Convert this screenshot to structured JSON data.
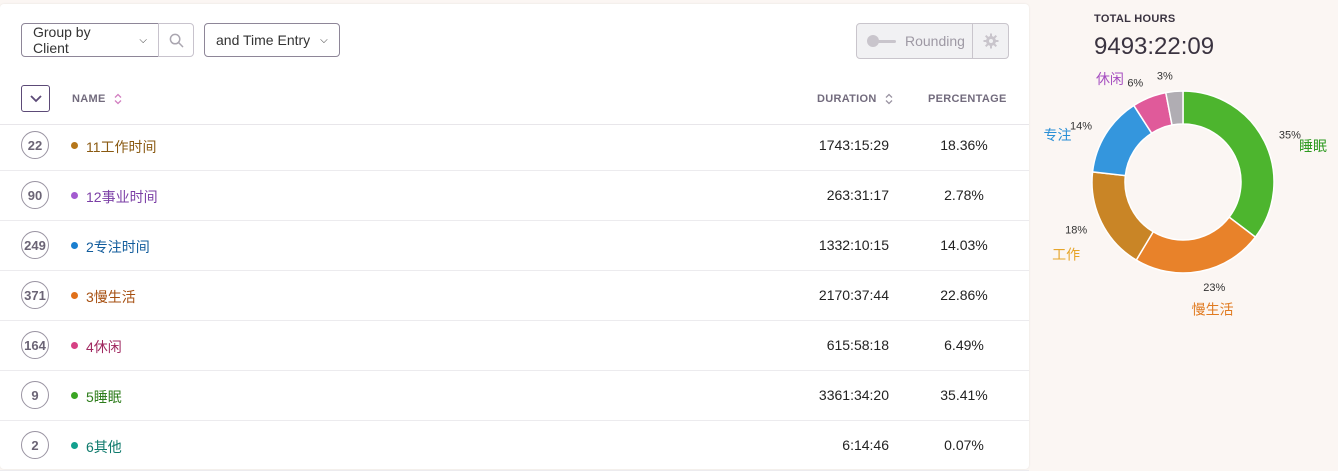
{
  "toolbar": {
    "group_label": "Group by Client",
    "time_label": "and Time Entry",
    "rounding_label": "Rounding"
  },
  "table": {
    "headers": {
      "name": "NAME",
      "duration": "DURATION",
      "percentage": "PERCENTAGE"
    },
    "rows": [
      {
        "count": "22",
        "name": "11工作时间",
        "duration": "1743:15:29",
        "percentage": "18.36%",
        "color": "#b5761a",
        "text_color": "#8a5a12"
      },
      {
        "count": "90",
        "name": "12事业时间",
        "duration": "263:31:17",
        "percentage": "2.78%",
        "color": "#a35bd0",
        "text_color": "#7b3fa6"
      },
      {
        "count": "249",
        "name": "2专注时间",
        "duration": "1332:10:15",
        "percentage": "14.03%",
        "color": "#1a7fd0",
        "text_color": "#125c9c"
      },
      {
        "count": "371",
        "name": "3慢生活",
        "duration": "2170:37:44",
        "percentage": "22.86%",
        "color": "#e0701a",
        "text_color": "#a64f10"
      },
      {
        "count": "164",
        "name": "4休闲",
        "duration": "615:58:18",
        "percentage": "6.49%",
        "color": "#d64184",
        "text_color": "#a02860"
      },
      {
        "count": "9",
        "name": "5睡眠",
        "duration": "3361:34:20",
        "percentage": "35.41%",
        "color": "#3aa524",
        "text_color": "#2e7d1c"
      },
      {
        "count": "2",
        "name": "6其他",
        "duration": "6:14:46",
        "percentage": "0.07%",
        "color": "#13a08e",
        "text_color": "#0e7a6c"
      }
    ]
  },
  "summary": {
    "label": "TOTAL HOURS",
    "value": "9493:22:09"
  },
  "chart_data": {
    "type": "pie",
    "segments": [
      {
        "name": "睡眠",
        "percent": 35,
        "label": "35%",
        "color": "#4db52e",
        "label_color": "#2e9a20"
      },
      {
        "name": "慢生活",
        "percent": 23,
        "label": "23%",
        "color": "#e8822a",
        "label_color": "#e07a20"
      },
      {
        "name": "工作",
        "percent": 18,
        "label": "18%",
        "color": "#c98526",
        "label_color": "#e6a52a"
      },
      {
        "name": "专注",
        "percent": 14,
        "label": "14%",
        "color": "#3496dd",
        "label_color": "#2a8fd6"
      },
      {
        "name": "休闲",
        "percent": 6,
        "label": "6%",
        "color": "#e05a9a",
        "label_color": "#a64fc0"
      },
      {
        "name": "",
        "percent": 3,
        "label": "3%",
        "color": "#b0adb3",
        "label_color": "#333333"
      }
    ]
  }
}
